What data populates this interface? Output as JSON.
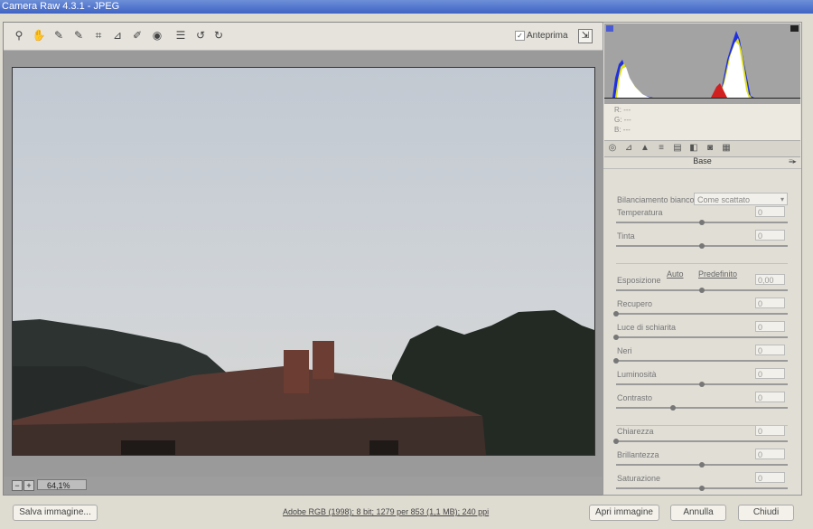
{
  "window": {
    "title": "Camera Raw 4.3.1  -  JPEG"
  },
  "toolbar": {
    "tools": [
      {
        "name": "zoom-tool-icon",
        "glyph": "⚲"
      },
      {
        "name": "hand-tool-icon",
        "glyph": "✋"
      },
      {
        "name": "white-balance-tool-icon",
        "glyph": "✎"
      },
      {
        "name": "color-sampler-tool-icon",
        "glyph": "✎"
      },
      {
        "name": "crop-tool-icon",
        "glyph": "⌗"
      },
      {
        "name": "straighten-tool-icon",
        "glyph": "⊿"
      },
      {
        "name": "retouch-tool-icon",
        "glyph": "✐"
      },
      {
        "name": "red-eye-tool-icon",
        "glyph": "◉"
      },
      {
        "name": "preferences-icon",
        "glyph": "☰"
      },
      {
        "name": "rotate-left-icon",
        "glyph": "↺"
      },
      {
        "name": "rotate-right-icon",
        "glyph": "↻"
      }
    ],
    "preview_label": "Anteprima",
    "preview_checked": true
  },
  "zoom": {
    "value": "64,1%"
  },
  "rgb_readout": {
    "r": "R:  ---",
    "g": "G:  ---",
    "b": "B:  ---"
  },
  "panel": {
    "title": "Base",
    "white_balance_label": "Bilanciamento bianco:",
    "white_balance_value": "Come scattato",
    "auto_label": "Auto",
    "default_label": "Predefinito",
    "sliders": [
      {
        "label": "Temperatura",
        "value": "0",
        "pos": 0.5
      },
      {
        "label": "Tinta",
        "value": "0",
        "pos": 0.5
      },
      {
        "label": "Esposizione",
        "value": "0,00",
        "pos": 0.5
      },
      {
        "label": "Recupero",
        "value": "0",
        "pos": 0.0
      },
      {
        "label": "Luce di schiarita",
        "value": "0",
        "pos": 0.0
      },
      {
        "label": "Neri",
        "value": "0",
        "pos": 0.0
      },
      {
        "label": "Luminosità",
        "value": "0",
        "pos": 0.5
      },
      {
        "label": "Contrasto",
        "value": "0",
        "pos": 0.33
      },
      {
        "label": "Chiarezza",
        "value": "0",
        "pos": 0.0
      },
      {
        "label": "Brillantezza",
        "value": "0",
        "pos": 0.5
      },
      {
        "label": "Saturazione",
        "value": "0",
        "pos": 0.5
      }
    ]
  },
  "footer": {
    "save_label": "Salva immagine...",
    "info": "Adobe RGB (1998); 8 bit; 1279 per 853 (1,1 MB); 240 ppi",
    "open_label": "Apri immagine",
    "cancel_label": "Annulla",
    "close_label": "Chiudi"
  }
}
